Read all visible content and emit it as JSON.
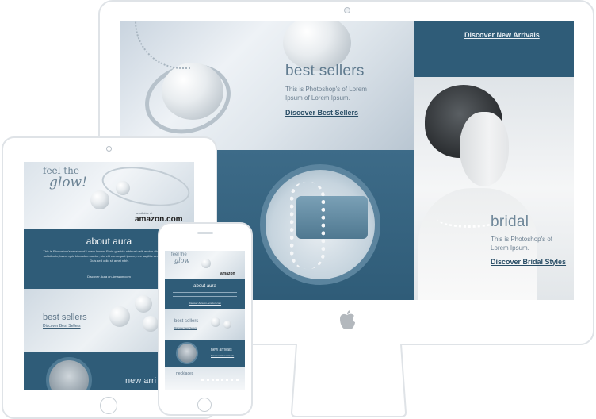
{
  "desktop": {
    "best_sellers": {
      "heading": "best sellers",
      "body": "This is Photoshop's of Lorem Ipsum of Lorem Ipsum.",
      "link": "Discover Best Sellers"
    },
    "new_arrivals": {
      "link": "Discover New Arrivals"
    },
    "bridal": {
      "heading": "bridal",
      "body": "This is Photoshop's of Lorem Ipsum.",
      "link": "Discover Bridal Styles"
    }
  },
  "tablet": {
    "hero_script_1": "feel the",
    "hero_script_2": "glow!",
    "amazon_small": "available at",
    "amazon_logo": "amazon.com",
    "about": {
      "heading": "about aura",
      "body": "This is Photoshop's version of Lorem Ipsum. Proin gravida nibh vel velit auctor aliquet. Aenean sollicitudin, lorem quis bibendum auctor, nisi elit consequat ipsum, nec sagittis sem nibh id elit. Duis sed odio sit amet nibh.",
      "link": "Discover Aura on Amazon.com"
    },
    "best_sellers": {
      "heading": "best sellers",
      "link": "Discover Best Sellers"
    },
    "new_arrivals": {
      "heading": "new arri"
    }
  },
  "phone": {
    "hero_script_1": "feel the",
    "hero_script_2": "glow",
    "amazon_logo": "amazon",
    "about": {
      "heading": "about aura",
      "link": "Discover Aura on Amazon.com"
    },
    "best_sellers": {
      "heading": "best sellers",
      "link": "Discover Best Sellers"
    },
    "new_arrivals": {
      "heading": "new arrivals",
      "link": "Discover New Arrivals"
    },
    "necklaces": {
      "heading": "necklaces"
    }
  },
  "colors": {
    "brand_blue": "#2f5c78",
    "frame": "#dfe3e7",
    "link_dark": "#2a4e66"
  },
  "icons": {
    "logo": "apple-logo-icon"
  }
}
